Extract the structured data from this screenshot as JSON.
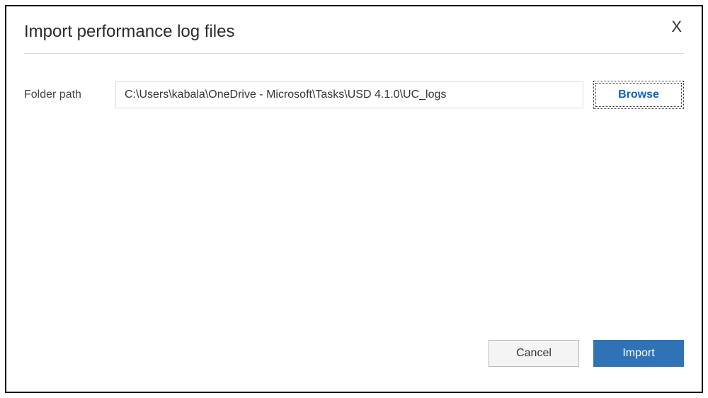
{
  "dialog": {
    "title": "Import performance log files",
    "close_label": "X"
  },
  "form": {
    "folder_path_label": "Folder path",
    "folder_path_value": "C:\\Users\\kabala\\OneDrive - Microsoft\\Tasks\\USD 4.1.0\\UC_logs",
    "browse_label": "Browse"
  },
  "footer": {
    "cancel_label": "Cancel",
    "import_label": "Import"
  }
}
